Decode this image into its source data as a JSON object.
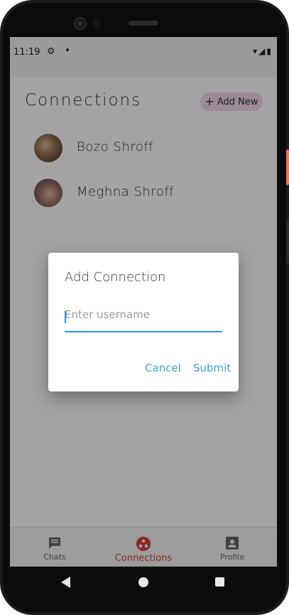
{
  "status": {
    "time": "11:19",
    "gear_icon": "⚙",
    "dot": "•",
    "right_icons": "▾◢▮"
  },
  "header": {
    "title": "Connections",
    "add_button": {
      "icon": "+",
      "label": "Add New"
    }
  },
  "contacts": [
    {
      "name": "Bozo Shroff"
    },
    {
      "name": "Meghna Shroff"
    }
  ],
  "bottom_nav": [
    {
      "label": "Chats",
      "icon": "chat-icon",
      "active": false
    },
    {
      "label": "Connections",
      "icon": "connections-icon",
      "active": true
    },
    {
      "label": "Profile",
      "icon": "profile-icon",
      "active": false
    }
  ],
  "dialog": {
    "title": "Add Connection",
    "input_placeholder": "Enter username",
    "input_value": "",
    "cancel_label": "Cancel",
    "submit_label": "Submit"
  },
  "colors": {
    "accent": "#2196f3",
    "active_nav": "#e03a3a",
    "add_button_bg": "#f4d9ea"
  }
}
